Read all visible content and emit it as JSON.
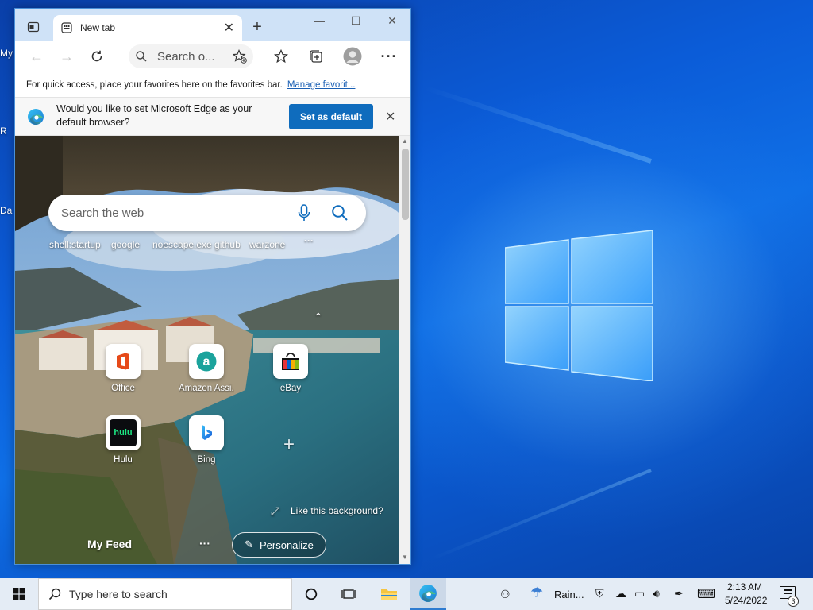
{
  "desktop": {
    "labels": [
      "My",
      "R",
      "Da"
    ]
  },
  "browser": {
    "tab": {
      "title": "New tab"
    },
    "address": {
      "placeholder": "Search o..."
    },
    "favorites_bar": {
      "message": "For quick access, place your favorites here on the favorites bar.",
      "link": "Manage favorit..."
    },
    "infobar": {
      "message": "Would you like to set Microsoft Edge as your default browser?",
      "button": "Set as default"
    },
    "new_tab_page": {
      "search_placeholder": "Search the web",
      "recent_searches": [
        "shell:startup",
        "google",
        "noescape.exe github",
        "warzone"
      ],
      "tiles": [
        {
          "label": "Office",
          "icon": "office-icon"
        },
        {
          "label": "Amazon Assi...",
          "icon": "amazon-icon"
        },
        {
          "label": "eBay",
          "icon": "ebay-icon"
        },
        {
          "label": "Hulu",
          "icon": "hulu-icon"
        },
        {
          "label": "Bing",
          "icon": "bing-icon"
        }
      ],
      "hulu_logo_text": "hulu",
      "like_background": "Like this background?",
      "my_feed": "My Feed",
      "personalize": "Personalize"
    }
  },
  "taskbar": {
    "search_text": "Type here to search",
    "weather": "Rain...",
    "time": "2:13 AM",
    "date": "5/24/2022",
    "notification_count": "3"
  },
  "colors": {
    "accent": "#0f6cbd",
    "titlebar": "#cfe2f7",
    "taskbar": "#e4ecf5"
  }
}
